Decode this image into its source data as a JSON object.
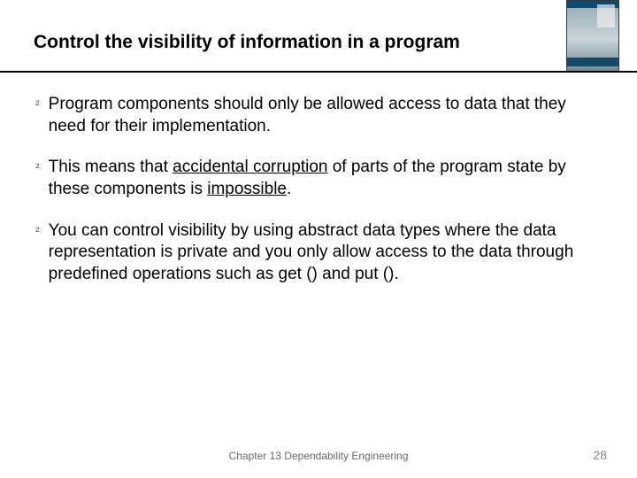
{
  "title": "Control the visibility of information in a program",
  "bullets": [
    {
      "segments": [
        {
          "text": "Program components should only be allowed access to data that they need for their implementation.",
          "u": false
        }
      ]
    },
    {
      "segments": [
        {
          "text": "This means that ",
          "u": false
        },
        {
          "text": "accidental corruption",
          "u": true
        },
        {
          "text": " of parts of the program state by these components is ",
          "u": false
        },
        {
          "text": "impossible",
          "u": true
        },
        {
          "text": ".",
          "u": false
        }
      ]
    },
    {
      "segments": [
        {
          "text": "You can control visibility by using abstract data types where the data representation is private and you only allow access to the data through predefined operations such as get () and put ().",
          "u": false
        }
      ]
    }
  ],
  "bullet_marker": "²",
  "footer": "Chapter 13 Dependability Engineering",
  "page_number": "28"
}
